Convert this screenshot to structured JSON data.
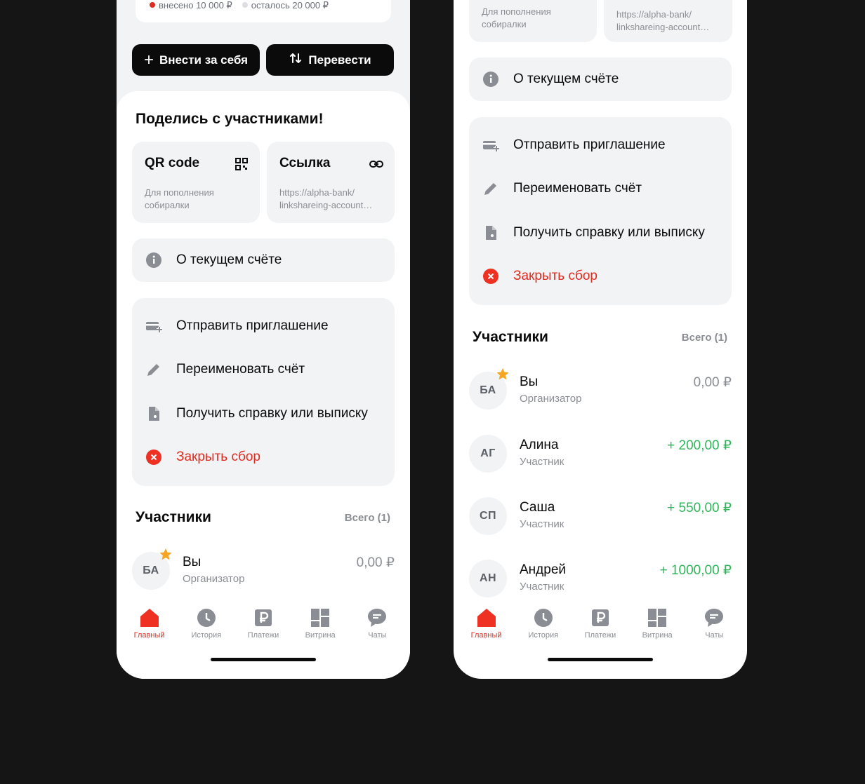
{
  "colors": {
    "background": "#151515",
    "accent": "#e02b1f",
    "positive": "#2fb559",
    "card_gray": "#f2f3f5",
    "star": "#f5a623"
  },
  "progress": {
    "paid_label": "внесено 10 000 ₽",
    "remaining_label": "осталось 20 000 ₽"
  },
  "actions": {
    "contribute": "Внести за себя",
    "transfer": "Перевести"
  },
  "share": {
    "title": "Поделись с участниками!",
    "qr": {
      "title": "QR code",
      "sub_line1": "Для пополнения",
      "sub_line2": "собиралки",
      "icon": "qr-code-icon"
    },
    "link": {
      "title": "Ссылка",
      "sub_line1": "https://alpha-bank/",
      "sub_line2": "linkshareing-account…",
      "icon": "link-icon"
    }
  },
  "about": {
    "label": "О текущем счёте",
    "icon": "info-icon"
  },
  "menu": {
    "invite": "Отправить приглашение",
    "rename": "Переименовать счёт",
    "statement": "Получить справку или выписку",
    "close": "Закрыть сбор"
  },
  "participants": {
    "title": "Участники",
    "count": "Всего (1)",
    "members": [
      {
        "initials": "БА",
        "name": "Вы",
        "role": "Организатор",
        "amount": "0,00 ₽",
        "organizer": true
      },
      {
        "initials": "АГ",
        "name": "Алина",
        "role": "Участник",
        "amount": "+ 200,00 ₽"
      },
      {
        "initials": "СП",
        "name": "Саша",
        "role": "Участник",
        "amount": "+ 550,00 ₽"
      },
      {
        "initials": "АН",
        "name": "Андрей",
        "role": "Участник",
        "amount": "+ 1000,00 ₽"
      }
    ]
  },
  "tabs": [
    {
      "label": "Главный",
      "icon": "home-icon",
      "active": true
    },
    {
      "label": "История",
      "icon": "clock-icon"
    },
    {
      "label": "Платежи",
      "icon": "ruble-icon"
    },
    {
      "label": "Витрина",
      "icon": "grid-icon"
    },
    {
      "label": "Чаты",
      "icon": "chat-icon"
    }
  ]
}
